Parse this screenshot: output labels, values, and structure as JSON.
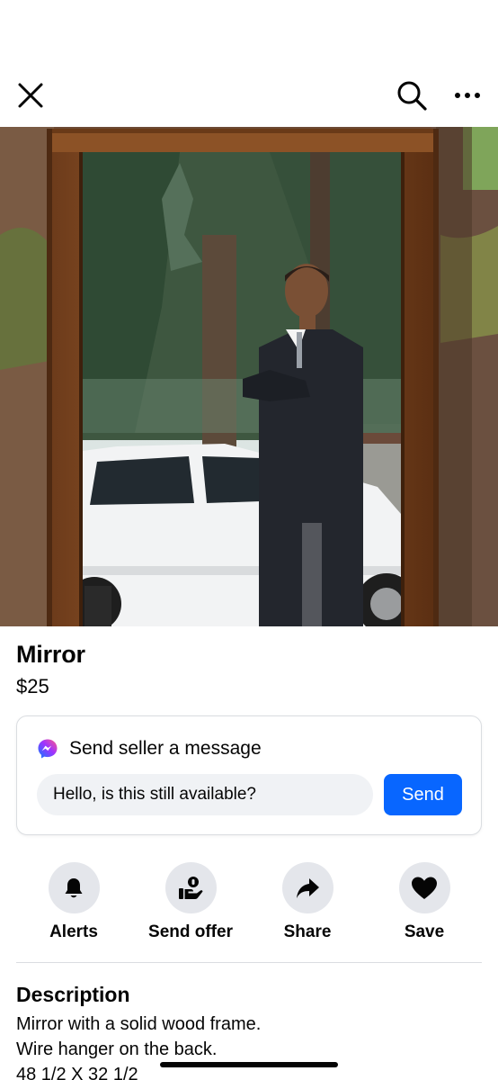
{
  "nav": {
    "close_icon": "close-icon",
    "search_icon": "search-icon",
    "more_icon": "more-horizontal-icon"
  },
  "photo": {
    "description_icon": "listing-photo"
  },
  "listing": {
    "title": "Mirror",
    "price": "$25"
  },
  "message_card": {
    "heading": "Send seller a message",
    "input_value": "Hello, is this still available?",
    "send_label": "Send",
    "accent_color": "#0866ff"
  },
  "actions": [
    {
      "label": "Alerts",
      "icon": "bell-icon"
    },
    {
      "label": "Send offer",
      "icon": "offer-icon"
    },
    {
      "label": "Share",
      "icon": "share-arrow-icon"
    },
    {
      "label": "Save",
      "icon": "heart-icon"
    }
  ],
  "description": {
    "heading": "Description",
    "lines": [
      "Mirror with a solid wood frame.",
      "Wire hanger on the back.",
      "48 1/2 X 32 1/2"
    ]
  }
}
